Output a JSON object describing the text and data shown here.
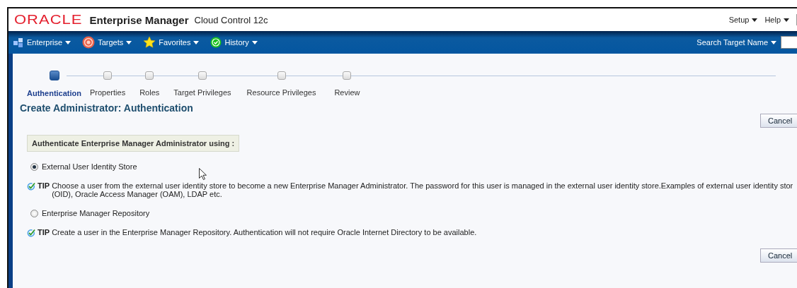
{
  "header": {
    "logo": "ORACLE",
    "product": "Enterprise Manager",
    "edition": "Cloud Control 12c",
    "links": [
      {
        "label": "Setup"
      },
      {
        "label": "Help"
      }
    ]
  },
  "nav": {
    "menus": [
      {
        "label": "Enterprise",
        "kind": "enterprise"
      },
      {
        "label": "Targets",
        "kind": "targets"
      },
      {
        "label": "Favorites",
        "kind": "favorites"
      },
      {
        "label": "History",
        "kind": "history"
      }
    ],
    "search": {
      "label": "Search Target Name"
    }
  },
  "train": {
    "steps": [
      {
        "label": "Authentication",
        "selected": true
      },
      {
        "label": "Properties",
        "selected": false
      },
      {
        "label": "Roles",
        "selected": false
      },
      {
        "label": "Target Privileges",
        "selected": false
      },
      {
        "label": "Resource Privileges",
        "selected": false
      },
      {
        "label": "Review",
        "selected": false
      }
    ]
  },
  "page_title": "Create Administrator: Authentication",
  "cancel_buttons": [
    "Cancel",
    "Cancel"
  ],
  "section_header": "Authenticate Enterprise Manager Administrator using :",
  "options": [
    {
      "label": "External User Identity Store",
      "selected": true,
      "tip_label": "TIP",
      "tip_lines": [
        "Choose a user from the external user identity store to become a new Enterprise Manager Administrator. The password for this user is managed in the external user identity store.Examples of external user identity stor",
        "(OID), Oracle Access Manager (OAM), LDAP etc."
      ]
    },
    {
      "label": "Enterprise Manager Repository",
      "selected": false,
      "tip_label": "TIP",
      "tip_lines": [
        "Create a user in the Enterprise Manager Repository. Authentication will not require Oracle Internet Directory to be available."
      ]
    }
  ]
}
